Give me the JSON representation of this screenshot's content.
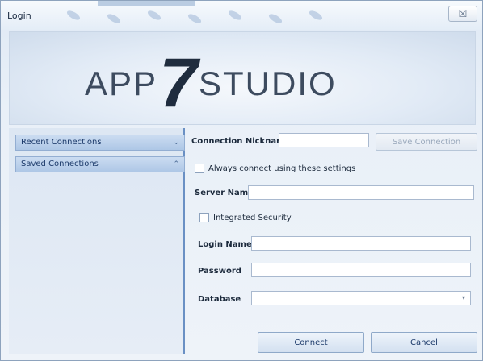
{
  "window": {
    "title": "Login",
    "close_glyph": "☒"
  },
  "banner": {
    "logo_left": "APP",
    "logo_number": "7",
    "logo_right": "STUDIO"
  },
  "sidebar": {
    "items": [
      {
        "label": "Recent Connections",
        "chevron": "⌄"
      },
      {
        "label": "Saved Connections",
        "chevron": "⌃"
      }
    ]
  },
  "form": {
    "nickname_label": "Connection Nickname",
    "nickname_value": "",
    "save_connection_label": "Save Connection",
    "always_connect_label": "Always connect using these settings",
    "always_connect_checked": false,
    "server_name_label": "Server Name",
    "server_name_value": "",
    "integrated_security_label": "Integrated Security",
    "integrated_security_checked": false,
    "login_name_label": "Login Name",
    "login_name_value": "",
    "password_label": "Password",
    "password_value": "",
    "database_label": "Database",
    "database_value": "",
    "database_arrow": "▾"
  },
  "footer": {
    "connect_label": "Connect",
    "cancel_label": "Cancel"
  },
  "colors": {
    "accent": "#6a90c4",
    "logo_text": "#3d4b5f",
    "logo_seven": "#1f2c3e"
  }
}
